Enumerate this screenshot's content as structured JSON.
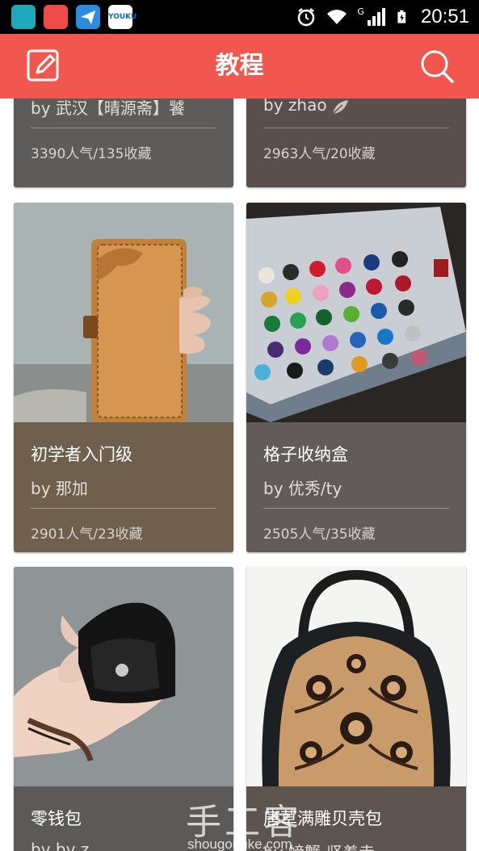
{
  "status_bar": {
    "time": "20:51",
    "network": "G",
    "app_icons": [
      "huawei-market-icon",
      "scissors-app-icon",
      "paper-plane-app-icon",
      "youku-app-icon"
    ],
    "youku_label": "YOUKU 优酷"
  },
  "app_bar": {
    "title": "教程",
    "color": "#f1574f"
  },
  "cards": [
    {
      "author": "by 武汉【晴源斋】饕",
      "stats": "3390人气/135收藏",
      "color": "#5e5c5a"
    },
    {
      "author": "by zhao",
      "stats": "2963人气/20收藏",
      "color": "#5a4f4c"
    },
    {
      "title": "初学者入门级",
      "author": "by 那加",
      "stats": "2901人气/23收藏",
      "color": "#6e604d"
    },
    {
      "title": "格子收纳盒",
      "author": "by 优秀/ty",
      "stats": "2505人气/35收藏",
      "color": "#615b59"
    },
    {
      "title": "零钱包",
      "author": "by by z",
      "color": "#5c5a58"
    },
    {
      "title": "唐草满雕贝壳包",
      "author": "by 螃蟹-竖着走",
      "color": "#5d534f"
    }
  ],
  "watermark": {
    "logo_text": "手工客",
    "url": "shougongke.com"
  }
}
